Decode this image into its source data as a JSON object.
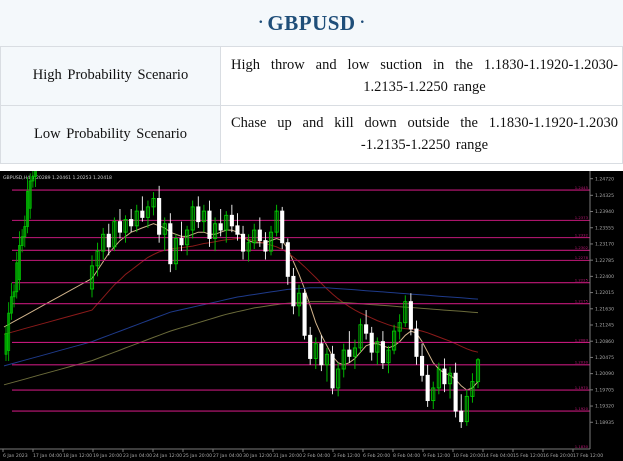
{
  "header": {
    "title": "GBPUSD"
  },
  "scenarios": [
    {
      "label": "High Probability Scenario",
      "text": "High throw and low suction in the 1.1830-1.1920-1.2030-1.2135-1.2250 range"
    },
    {
      "label": "Low Probability Scenario",
      "text": "Chase up and kill down outside the 1.1830-1.1920-1.2030 -1.2135-1.2250 range"
    }
  ],
  "chart_header": "GBPUSD,H4 1.20289 1.20461 1.20253 1.20418",
  "chart_data": {
    "type": "candlestick",
    "symbol": "GBPUSD",
    "timeframe": "H4",
    "ohlc": {
      "open": 1.20289,
      "high": 1.20461,
      "low": 1.20253,
      "close": 1.20418
    },
    "ylim": [
      1.183,
      1.2476
    ],
    "y_ticks": [
      "1.24720",
      "1.24325",
      "1.23940",
      "1.23555",
      "1.23170",
      "1.22785",
      "1.22400",
      "1.22015",
      "1.21630",
      "1.21245",
      "1.20860",
      "1.20475",
      "1.20090",
      "1.19705",
      "1.19320",
      "1.18935"
    ],
    "x_ticks": [
      "6 Jan 2023",
      "17 Jan 04:00",
      "18 Jan 12:00",
      "19 Jan 20:00",
      "23 Jan 04:00",
      "24 Jan 12:00",
      "25 Jan 20:00",
      "27 Jan 04:00",
      "30 Jan 12:00",
      "31 Jan 20:00",
      "2 Feb 04:00",
      "3 Feb 12:00",
      "6 Feb 20:00",
      "8 Feb 04:00",
      "9 Feb 12:00",
      "10 Feb 20:00",
      "14 Feb 04:00",
      "15 Feb 12:00",
      "16 Feb 20:00",
      "17 Feb 12:00"
    ],
    "levels": [
      {
        "label": "1.2445",
        "value": 1.2445
      },
      {
        "label": "1.2373",
        "value": 1.2373
      },
      {
        "label": "1.2332",
        "value": 1.2332
      },
      {
        "label": "1.2302",
        "value": 1.2302
      },
      {
        "label": "1.2278",
        "value": 1.2278
      },
      {
        "label": "1.2225",
        "value": 1.2225
      },
      {
        "label": "1.2175",
        "value": 1.2175
      },
      {
        "label": "1.2083",
        "value": 1.2083
      },
      {
        "label": "1.2030",
        "value": 1.203
      },
      {
        "label": "1.1970",
        "value": 1.197
      },
      {
        "label": "1.1920",
        "value": 1.192
      },
      {
        "label": "1.1830",
        "value": 1.183
      }
    ],
    "candles": [
      [
        1.221,
        1.229,
        1.219,
        1.2265
      ],
      [
        1.2265,
        1.232,
        1.224,
        1.23
      ],
      [
        1.23,
        1.2355,
        1.228,
        1.234
      ],
      [
        1.234,
        1.2365,
        1.229,
        1.231
      ],
      [
        1.231,
        1.238,
        1.23,
        1.237
      ],
      [
        1.237,
        1.24,
        1.233,
        1.2345
      ],
      [
        1.2345,
        1.2385,
        1.232,
        1.2375
      ],
      [
        1.2375,
        1.24,
        1.2345,
        1.236
      ],
      [
        1.236,
        1.241,
        1.2345,
        1.2395
      ],
      [
        1.2395,
        1.243,
        1.237,
        1.238
      ],
      [
        1.238,
        1.242,
        1.2355,
        1.2405
      ],
      [
        1.2405,
        1.244,
        1.2385,
        1.2425
      ],
      [
        1.2425,
        1.2455,
        1.232,
        1.234
      ],
      [
        1.234,
        1.238,
        1.23,
        1.2365
      ],
      [
        1.2365,
        1.239,
        1.225,
        1.227
      ],
      [
        1.227,
        1.234,
        1.2255,
        1.233
      ],
      [
        1.233,
        1.237,
        1.23,
        1.2315
      ],
      [
        1.2315,
        1.236,
        1.229,
        1.235
      ],
      [
        1.235,
        1.242,
        1.233,
        1.2405
      ],
      [
        1.2405,
        1.243,
        1.2355,
        1.237
      ],
      [
        1.237,
        1.241,
        1.2345,
        1.2395
      ],
      [
        1.2395,
        1.242,
        1.231,
        1.233
      ],
      [
        1.233,
        1.238,
        1.23,
        1.2365
      ],
      [
        1.2365,
        1.24,
        1.2335,
        1.235
      ],
      [
        1.235,
        1.2395,
        1.232,
        1.2385
      ],
      [
        1.2385,
        1.241,
        1.2345,
        1.236
      ],
      [
        1.236,
        1.239,
        1.2325,
        1.234
      ],
      [
        1.234,
        1.236,
        1.228,
        1.23
      ],
      [
        1.23,
        1.234,
        1.2275,
        1.232
      ],
      [
        1.232,
        1.2365,
        1.2305,
        1.235
      ],
      [
        1.235,
        1.238,
        1.231,
        1.2325
      ],
      [
        1.2325,
        1.2345,
        1.228,
        1.23
      ],
      [
        1.23,
        1.236,
        1.229,
        1.2345
      ],
      [
        1.2345,
        1.241,
        1.2335,
        1.2395
      ],
      [
        1.2395,
        1.2405,
        1.2305,
        1.232
      ],
      [
        1.232,
        1.233,
        1.222,
        1.224
      ],
      [
        1.224,
        1.226,
        1.215,
        1.217
      ],
      [
        1.217,
        1.222,
        1.2145,
        1.22
      ],
      [
        1.22,
        1.221,
        1.209,
        1.21
      ],
      [
        1.21,
        1.212,
        1.203,
        1.2045
      ],
      [
        1.2045,
        1.2095,
        1.202,
        1.208
      ],
      [
        1.208,
        1.21,
        1.2015,
        1.203
      ],
      [
        1.203,
        1.207,
        1.199,
        1.2055
      ],
      [
        1.2055,
        1.2075,
        1.196,
        1.1975
      ],
      [
        1.1975,
        1.2035,
        1.1955,
        1.202
      ],
      [
        1.202,
        1.208,
        1.2,
        1.2065
      ],
      [
        1.2065,
        1.211,
        1.2035,
        1.205
      ],
      [
        1.205,
        1.209,
        1.202,
        1.207
      ],
      [
        1.207,
        1.214,
        1.206,
        1.2125
      ],
      [
        1.2125,
        1.216,
        1.209,
        1.2105
      ],
      [
        1.2105,
        1.212,
        1.204,
        1.206
      ],
      [
        1.206,
        1.2095,
        1.203,
        1.2085
      ],
      [
        1.2085,
        1.211,
        1.202,
        1.2035
      ],
      [
        1.2035,
        1.2075,
        1.201,
        1.2065
      ],
      [
        1.2065,
        1.2125,
        1.2055,
        1.211
      ],
      [
        1.211,
        1.215,
        1.209,
        1.213
      ],
      [
        1.213,
        1.2195,
        1.212,
        1.218
      ],
      [
        1.218,
        1.22,
        1.21,
        1.2115
      ],
      [
        1.2115,
        1.2135,
        1.203,
        1.205
      ],
      [
        1.205,
        1.208,
        1.199,
        1.2005
      ],
      [
        1.2005,
        1.203,
        1.193,
        1.1945
      ],
      [
        1.1945,
        1.199,
        1.1925,
        1.1975
      ],
      [
        1.1975,
        1.2035,
        1.196,
        1.202
      ],
      [
        1.202,
        1.2045,
        1.1965,
        1.1985
      ],
      [
        1.1985,
        1.2025,
        1.195,
        1.201
      ],
      [
        1.201,
        1.2035,
        1.1905,
        1.192
      ],
      [
        1.192,
        1.196,
        1.188,
        1.1895
      ],
      [
        1.1895,
        1.197,
        1.1885,
        1.1955
      ],
      [
        1.1955,
        1.201,
        1.194,
        1.199
      ],
      [
        1.199,
        1.2046,
        1.1975,
        1.2042
      ]
    ],
    "moving_averages": [
      {
        "name": "MA1",
        "color": "#d2b48c",
        "values": [
          1.2235,
          1.2255,
          1.2275,
          1.2295,
          1.231,
          1.2325,
          1.2335,
          1.2345,
          1.235,
          1.2355,
          1.236,
          1.2365,
          1.236,
          1.2355,
          1.2345,
          1.234,
          1.2335,
          1.2335,
          1.234,
          1.2345,
          1.2345,
          1.234,
          1.234,
          1.2345,
          1.235,
          1.235,
          1.2345,
          1.2335,
          1.2325,
          1.232,
          1.232,
          1.232,
          1.2325,
          1.233,
          1.2325,
          1.2305,
          1.2275,
          1.2245,
          1.221,
          1.217,
          1.213,
          1.21,
          1.2075,
          1.205,
          1.2035,
          1.203,
          1.2035,
          1.2045,
          1.206,
          1.2075,
          1.208,
          1.208,
          1.2075,
          1.207,
          1.2075,
          1.2085,
          1.21,
          1.211,
          1.2105,
          1.2085,
          1.206,
          1.2035,
          1.202,
          1.201,
          1.2005,
          1.1995,
          1.198,
          1.197,
          1.1975,
          1.199
        ]
      },
      {
        "name": "MA2",
        "color": "#8b1a1a",
        "values": [
          1.216,
          1.2175,
          1.219,
          1.2205,
          1.222,
          1.2232,
          1.2245,
          1.2255,
          1.2265,
          1.2275,
          1.2285,
          1.2292,
          1.2298,
          1.2302,
          1.2305,
          1.2307,
          1.2308,
          1.231,
          1.2312,
          1.2315,
          1.2318,
          1.232,
          1.2322,
          1.2325,
          1.2327,
          1.2328,
          1.233,
          1.233,
          1.2328,
          1.2325,
          1.2322,
          1.2318,
          1.2314,
          1.231,
          1.2304,
          1.2296,
          1.2286,
          1.2275,
          1.2263,
          1.225,
          1.2237,
          1.2223,
          1.221,
          1.2198,
          1.2187,
          1.2177,
          1.2168,
          1.216,
          1.2153,
          1.2147,
          1.2141,
          1.2135,
          1.213,
          1.2125,
          1.2121,
          1.2118,
          1.2116,
          1.2115,
          1.2113,
          1.211,
          1.2106,
          1.2101,
          1.2096,
          1.2091,
          1.2086,
          1.208,
          1.2074,
          1.2068,
          1.2063,
          1.206
        ]
      },
      {
        "name": "MA3",
        "color": "#1e3a8a",
        "values": [
          1.2085,
          1.209,
          1.2095,
          1.21,
          1.2105,
          1.211,
          1.2115,
          1.212,
          1.2125,
          1.213,
          1.2135,
          1.214,
          1.2145,
          1.215,
          1.2155,
          1.2158,
          1.2161,
          1.2164,
          1.2167,
          1.217,
          1.2173,
          1.2176,
          1.2179,
          1.2182,
          1.2185,
          1.2188,
          1.2191,
          1.2193,
          1.2195,
          1.2197,
          1.2199,
          1.2201,
          1.2203,
          1.2205,
          1.2207,
          1.2209,
          1.221,
          1.2211,
          1.2212,
          1.2213,
          1.2213,
          1.2213,
          1.2213,
          1.2212,
          1.2211,
          1.221,
          1.2209,
          1.2208,
          1.2207,
          1.2206,
          1.2205,
          1.2204,
          1.2203,
          1.2202,
          1.2201,
          1.22,
          1.2199,
          1.2198,
          1.2197,
          1.2196,
          1.2195,
          1.2194,
          1.2193,
          1.2192,
          1.2191,
          1.219,
          1.2189,
          1.2188,
          1.2187,
          1.2186
        ]
      },
      {
        "name": "MA4",
        "color": "#6b6b3a",
        "values": [
          1.204,
          1.2045,
          1.205,
          1.2055,
          1.206,
          1.2065,
          1.207,
          1.2075,
          1.208,
          1.2085,
          1.209,
          1.2095,
          1.21,
          1.2105,
          1.211,
          1.2114,
          1.2118,
          1.2122,
          1.2126,
          1.213,
          1.2134,
          1.2138,
          1.2142,
          1.2146,
          1.215,
          1.2153,
          1.2156,
          1.2159,
          1.2162,
          1.2165,
          1.2167,
          1.2169,
          1.2171,
          1.2173,
          1.2175,
          1.2176,
          1.2177,
          1.2178,
          1.2179,
          1.218,
          1.218,
          1.218,
          1.218,
          1.218,
          1.2179,
          1.2178,
          1.2177,
          1.2176,
          1.2175,
          1.2174,
          1.2173,
          1.2172,
          1.2171,
          1.217,
          1.2169,
          1.2168,
          1.2167,
          1.2166,
          1.2165,
          1.2164,
          1.2163,
          1.2162,
          1.2161,
          1.216,
          1.2159,
          1.2158,
          1.2157,
          1.2156,
          1.2155,
          1.2154
        ]
      }
    ],
    "grid": false
  },
  "colors": {
    "title": "#1f4e79",
    "level_line": "#c2187a",
    "up_candle": "#00c800",
    "down_candle": "#ffffff",
    "chart_bg": "#000000"
  }
}
